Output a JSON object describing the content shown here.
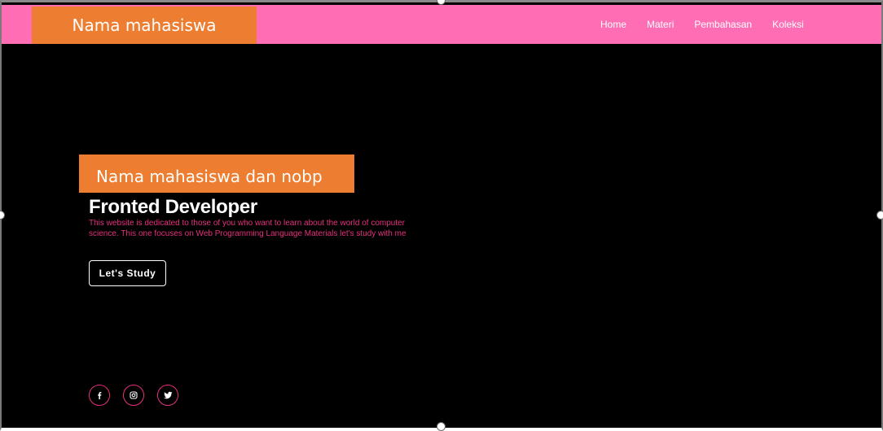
{
  "header": {
    "brand_label": "Nama mahasiswa",
    "nav": [
      {
        "label": "Home"
      },
      {
        "label": "Materi"
      },
      {
        "label": "Pembahasan"
      },
      {
        "label": "Koleksi"
      }
    ]
  },
  "hero": {
    "name_label": "Nama mahasiswa dan nobp",
    "title": "Fronted Developer",
    "description": "This website is dedicated to those of you who want to learn about the world of computer science. This one focuses on Web Programming Language Materials let's study with me",
    "cta_label": "Let's Study"
  },
  "socials": [
    {
      "icon": "facebook-icon"
    },
    {
      "icon": "instagram-icon"
    },
    {
      "icon": "twitter-icon"
    }
  ],
  "colors": {
    "navbar": "#ff6eb4",
    "label_box": "#ed7d31",
    "background": "#000000",
    "accent_pink": "#e6307e"
  }
}
